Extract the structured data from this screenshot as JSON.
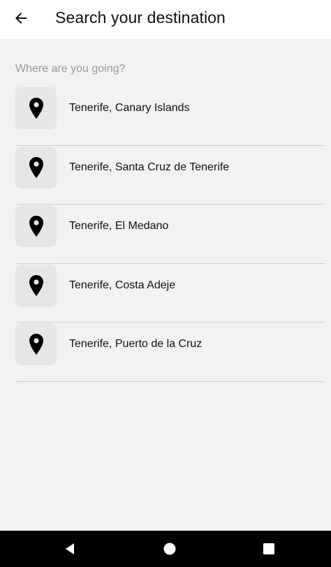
{
  "header": {
    "title": "Search your destination",
    "back_icon": "arrow-left-icon"
  },
  "search": {
    "placeholder": "Where are you going?",
    "value": ""
  },
  "results": [
    {
      "label": "Tenerife, Canary Islands",
      "icon": "location-pin-icon"
    },
    {
      "label": "Tenerife, Santa Cruz de Tenerife",
      "icon": "location-pin-icon"
    },
    {
      "label": "Tenerife, El Medano",
      "icon": "location-pin-icon"
    },
    {
      "label": "Tenerife, Costa Adeje",
      "icon": "location-pin-icon"
    },
    {
      "label": "Tenerife, Puerto de la Cruz",
      "icon": "location-pin-icon"
    }
  ],
  "navbar": {
    "buttons": [
      "back-triangle-icon",
      "home-circle-icon",
      "recents-square-icon"
    ]
  },
  "colors": {
    "background": "#f2f2f2",
    "header": "#ffffff",
    "pin_box": "#e6e6e6",
    "divider": "#cfcfcf",
    "navbar": "#000000"
  }
}
